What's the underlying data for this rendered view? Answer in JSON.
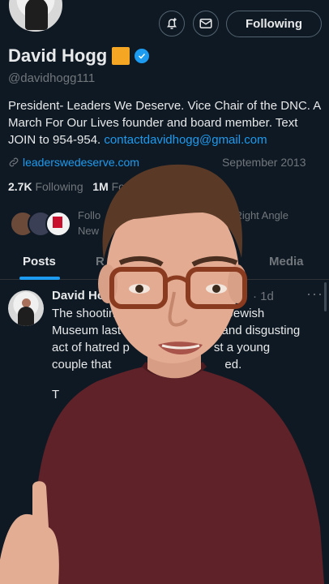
{
  "header": {
    "following_label": "Following"
  },
  "profile": {
    "name": "David Hogg",
    "handle": "@davidhogg111",
    "bio": "President- Leaders We Deserve. Vice Chair of the DNC. A March For Our Lives founder and board member. Text JOIN to 954-954.",
    "bio_email": "contactdavidhogg@gmail.com",
    "website": "leaderswedeserve.com",
    "joined": "September 2013",
    "following_count": "2.7K",
    "following_label": "Following",
    "followers_count": "1M",
    "followers_label": "Fo",
    "known_followers_line1": "Follo",
    "known_followers_line1b": "Right Angle",
    "known_followers_line2": "New"
  },
  "tabs": [
    {
      "label": "Posts"
    },
    {
      "label": "R"
    },
    {
      "label": "Media"
    }
  ],
  "tweet": {
    "author": "David Hog",
    "time": "· 1d",
    "more": "···",
    "line1a": "The shootin",
    "line1b": "tal Jewish",
    "line2": "Museum last",
    "line2b": "e and disgusting",
    "line3a": "act of hatred p",
    "line3b": "st a young",
    "line4a": "couple that",
    "line4b": "ed.",
    "line5": "T"
  },
  "colors": {
    "background": "#0f1923",
    "accent": "#1d9bf0",
    "muted": "#71767b",
    "text": "#e7e9ea",
    "flag": "#f5a623"
  }
}
